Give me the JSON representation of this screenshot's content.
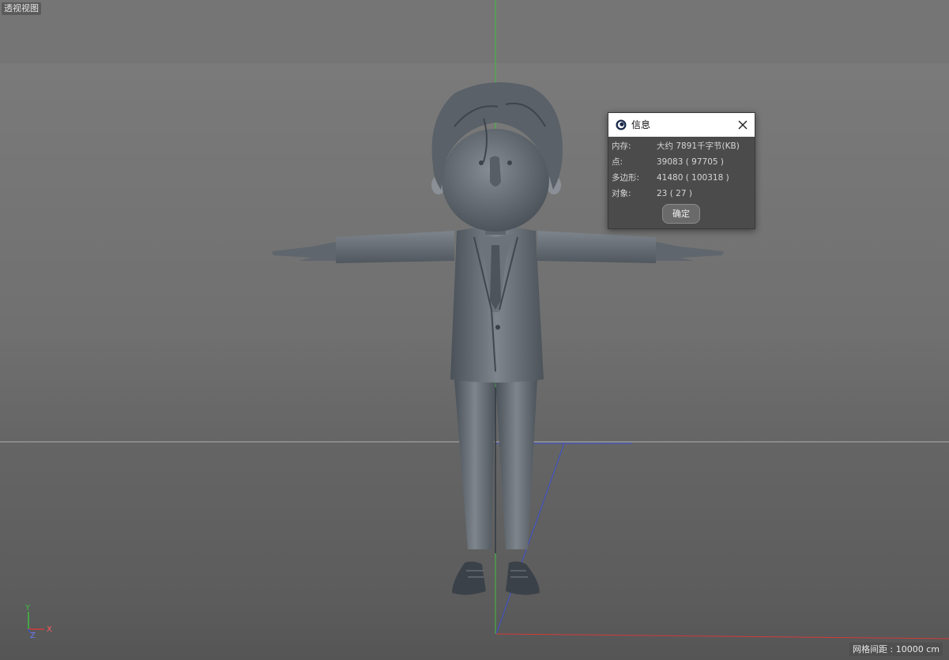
{
  "viewport": {
    "label": "透视视图",
    "grid_spacing": "网格间距 : 10000 cm",
    "axis_labels": {
      "y": "Y",
      "z": "Z",
      "x": "X"
    },
    "colors": {
      "y_axis": "#3fbf3f",
      "x_axis": "#d23a3a",
      "z_axis": "#3a4fd2",
      "horizon": "#b4b4b4"
    }
  },
  "model": {
    "icon": "character-model-tpose"
  },
  "info_dialog": {
    "title": "信息",
    "app_icon": "cinema4d-logo-icon",
    "close_icon": "close-icon",
    "rows": [
      {
        "key": "内存:",
        "value": "大约 7891千字节(KB)"
      },
      {
        "key": "点:",
        "value": "39083 ( 97705 )"
      },
      {
        "key": "多边形:",
        "value": "41480 ( 100318 )"
      },
      {
        "key": "对象:",
        "value": "23 ( 27 )"
      }
    ],
    "ok_label": "确定"
  }
}
